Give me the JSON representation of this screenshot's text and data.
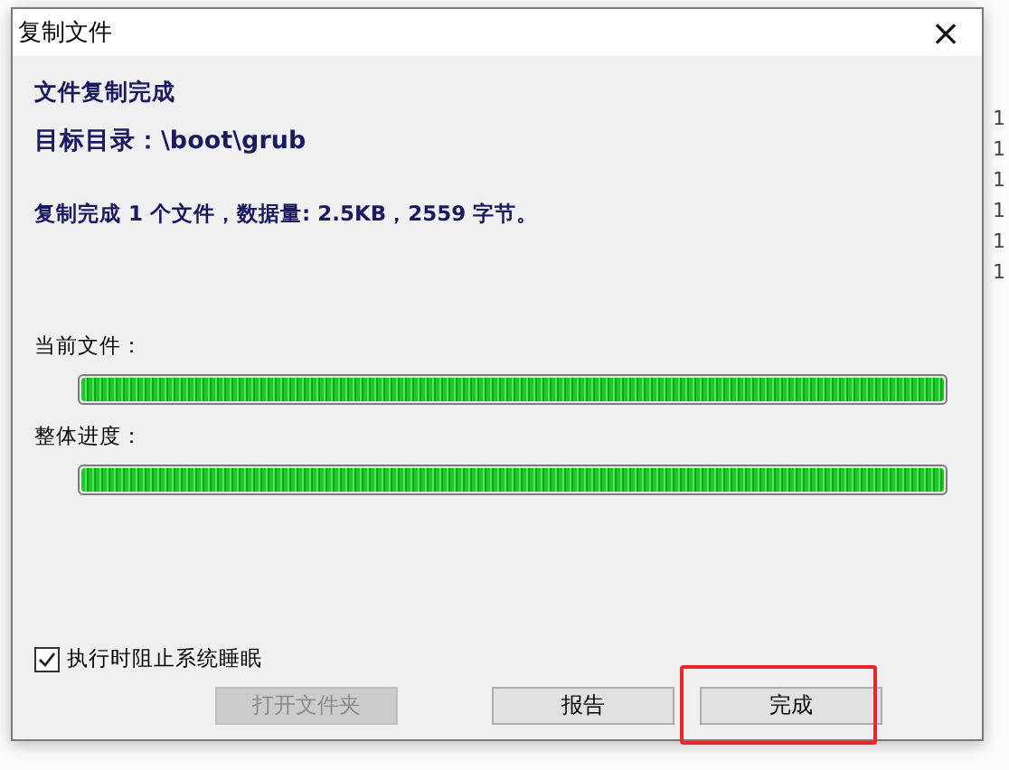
{
  "background_window": {
    "column_digits": [
      "1",
      "1",
      "1",
      "1",
      "1",
      "1"
    ]
  },
  "window": {
    "title": "复制文件",
    "close": "×"
  },
  "heading": "文件复制完成",
  "target": "目标目录：\\boot\\grub",
  "summary": "复制完成 1 个文件，数据量: 2.5KB，2559 字节。",
  "progress": [
    {
      "label": "当前文件：",
      "level": 1
    },
    {
      "label": "整体进度：",
      "level": 1
    }
  ],
  "option": {
    "label": "执行时阻止系统睡眠",
    "checked": true
  },
  "buttons": [
    {
      "label": "打开文件夹",
      "disabled": true,
      "highlighted": false
    },
    {
      "label": "报告",
      "disabled": false,
      "highlighted": false
    },
    {
      "label": "完成",
      "disabled": false,
      "highlighted": true
    }
  ]
}
